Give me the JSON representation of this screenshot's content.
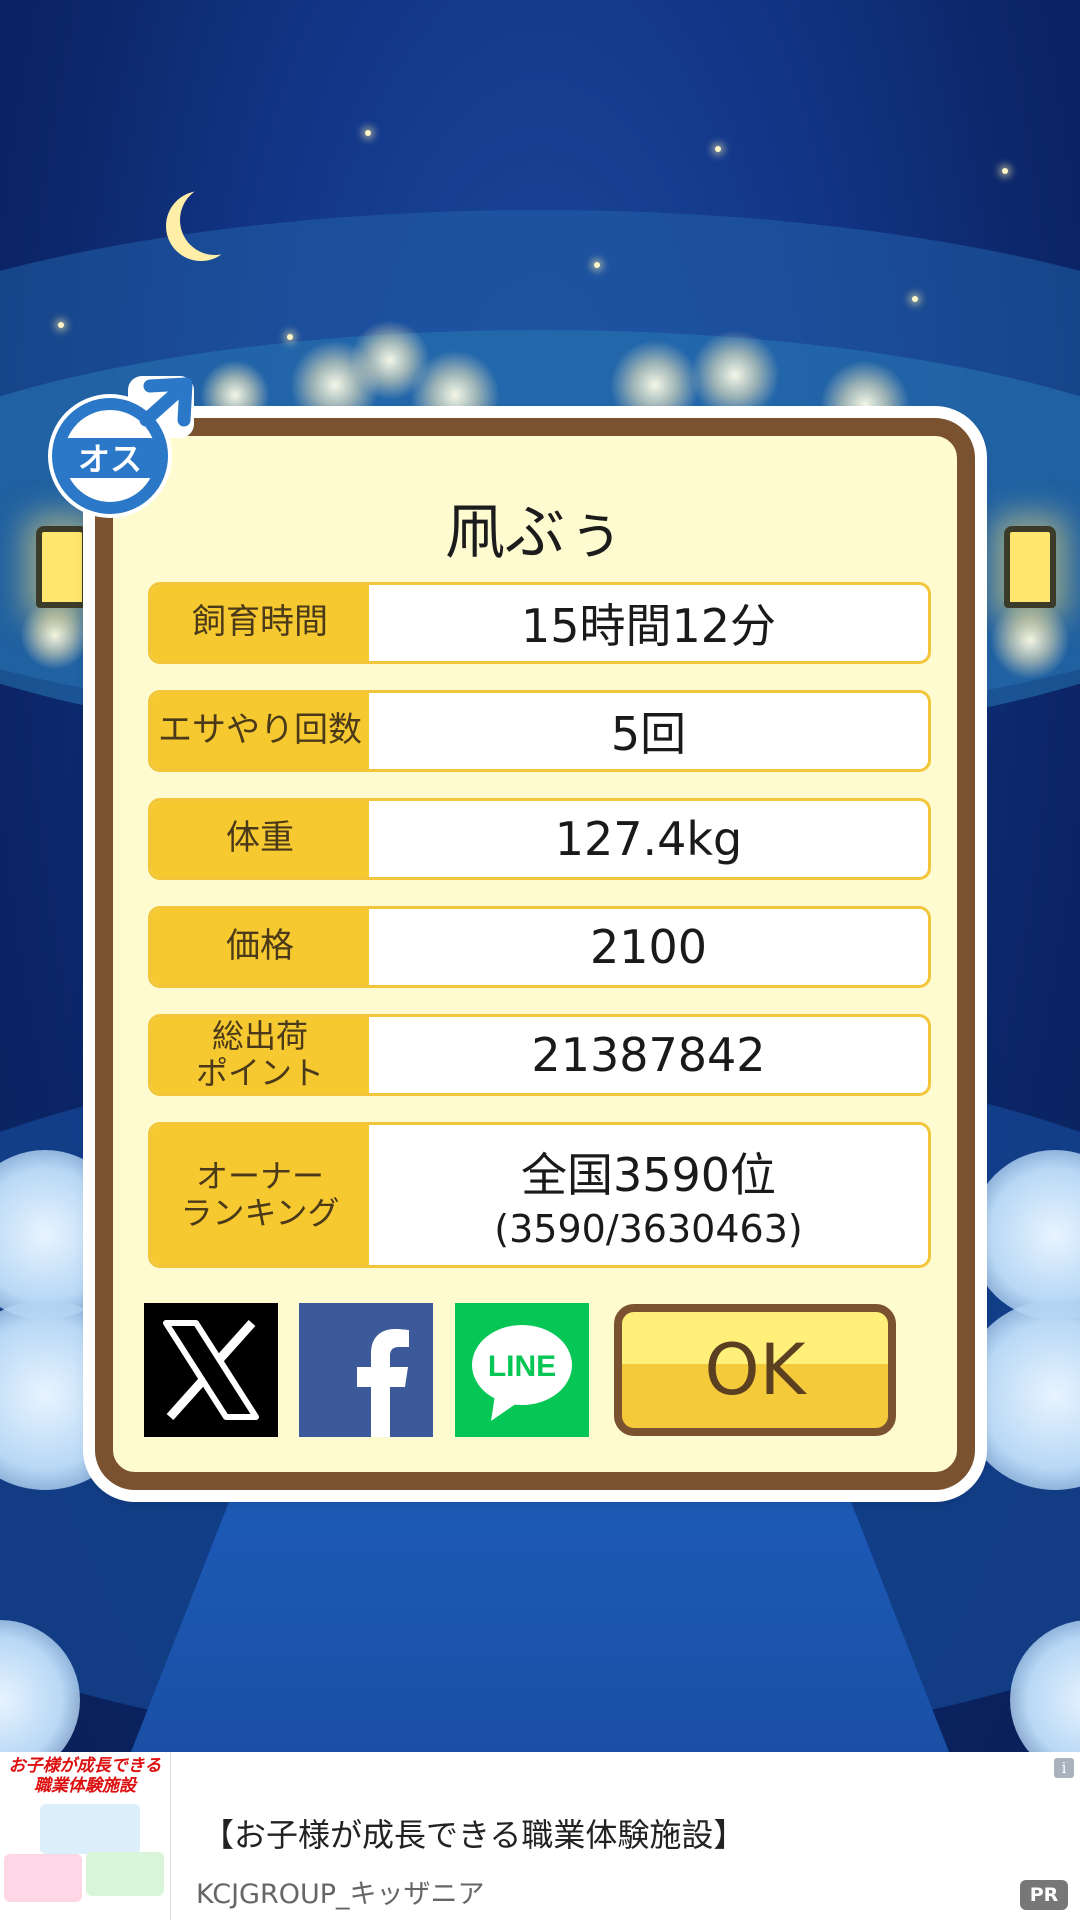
{
  "pet": {
    "name": "凧ぶぅ",
    "gender_badge_text": "オス",
    "gender_icon": "male-symbol-icon"
  },
  "stats": [
    {
      "label": "飼育時間",
      "value": "15時間12分",
      "sub": ""
    },
    {
      "label": "エサやり回数",
      "value": "5回",
      "sub": ""
    },
    {
      "label": "体重",
      "value": "127.4kg",
      "sub": ""
    },
    {
      "label": "価格",
      "value": "2100",
      "sub": ""
    },
    {
      "label": "総出荷\nポイント",
      "value": "21387842",
      "sub": ""
    },
    {
      "label": "オーナー\nランキング",
      "value": "全国3590位",
      "sub": "(3590/3630463)"
    }
  ],
  "share": {
    "x_icon": "x-logo-icon",
    "facebook_icon": "facebook-logo-icon",
    "line_label": "LINE"
  },
  "ok_label": "OK",
  "ad": {
    "thumb_title": "お子様が成長できる\n職業体験施設",
    "title": "【お子様が成長できる職業体験施設】",
    "sponsor": "KCJGROUP_キッザニア",
    "info_label": "i",
    "pr_label": "PR"
  },
  "colors": {
    "frame": "#7a5230",
    "panel": "#fffbd0",
    "label_bg": "#f7c930",
    "background": "#13388a"
  }
}
